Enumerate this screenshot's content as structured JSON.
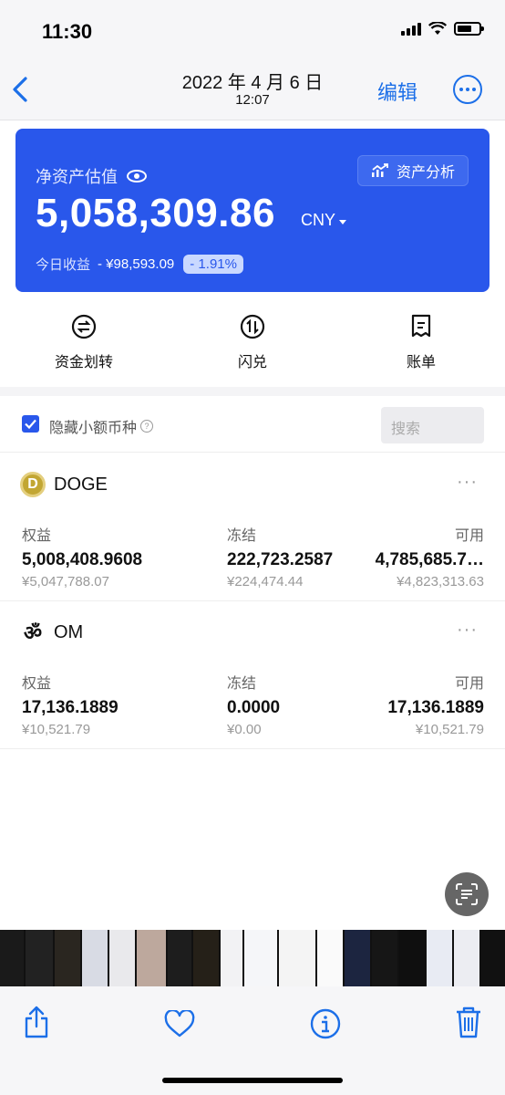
{
  "status_bar": {
    "time": "11:30"
  },
  "nav": {
    "title": "2022 年 4 月 6 日",
    "subtitle": "12:07",
    "edit_label": "编辑"
  },
  "asset_card": {
    "label": "净资产估值",
    "analysis_label": "资产分析",
    "value": "5,058,309.86",
    "currency": "CNY",
    "today_label": "今日收益",
    "today_amount": "- ¥98,593.09",
    "today_pct": "- 1.91%"
  },
  "actions": [
    {
      "label": "资金划转",
      "icon": "transfer-icon"
    },
    {
      "label": "闪兑",
      "icon": "swap-icon"
    },
    {
      "label": "账单",
      "icon": "bill-icon"
    }
  ],
  "filter": {
    "hide_small_label": "隐藏小额币种",
    "checked": true,
    "search_placeholder": "搜索"
  },
  "coins": [
    {
      "name": "DOGE",
      "logo_text": "D",
      "logo_color": "#c2a633",
      "equity_label": "权益",
      "equity": "5,008,408.9608",
      "equity_cny": "¥5,047,788.07",
      "frozen_label": "冻结",
      "frozen": "222,723.2587",
      "frozen_cny": "¥224,474.44",
      "available_label": "可用",
      "available": "4,785,685.7…",
      "available_cny": "¥4,823,313.63"
    },
    {
      "name": "OM",
      "logo_text": "ॐ",
      "logo_color": "#111111",
      "equity_label": "权益",
      "equity": "17,136.1889",
      "equity_cny": "¥10,521.79",
      "frozen_label": "冻结",
      "frozen": "0.0000",
      "frozen_cny": "¥0.00",
      "available_label": "可用",
      "available": "17,136.1889",
      "available_cny": "¥10,521.79"
    }
  ],
  "colors": {
    "accent": "#1c6fe8",
    "card": "#2957eb"
  }
}
